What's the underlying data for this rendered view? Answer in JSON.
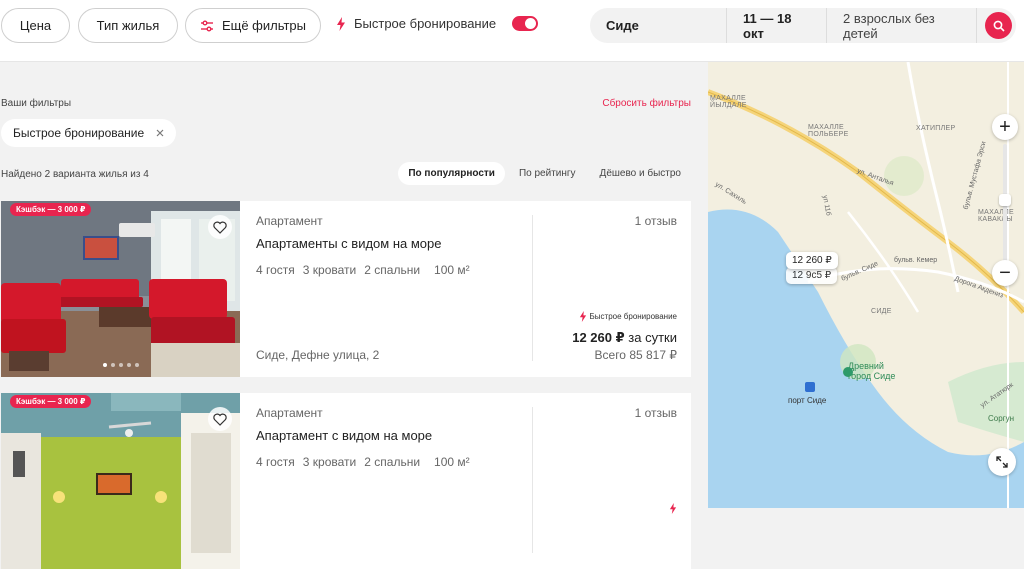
{
  "filters_bar": {
    "price": "Цена",
    "housing_type": "Тип жилья",
    "more_filters": "Ещё фильтры",
    "instant_booking": "Быстрое бронирование",
    "instant_booking_on": true
  },
  "search": {
    "location": "Сиде",
    "dates": "11 — 18 окт",
    "guests": "2 взрослых без детей"
  },
  "active_filters": {
    "title": "Ваши фильтры",
    "reset": "Сбросить фильтры",
    "chips": [
      "Быстрое бронирование"
    ]
  },
  "results": {
    "found_text": "Найдено 2 варианта жилья из 4",
    "sort_options": [
      "По популярности",
      "По рейтингу",
      "Дёшево и быстро"
    ],
    "active_sort": "По популярности"
  },
  "listings": [
    {
      "cashback": "Кэшбэк — 3 000 ₽",
      "type": "Апартамент",
      "title": "Апартаменты с видом на море",
      "guests": "4 гостя",
      "beds": "3 кровати",
      "bedrooms": "2 спальни",
      "area": "100 м²",
      "address": "Сиде, Дефне улица, 2",
      "reviews": "1 отзыв",
      "instant_label": "Быстрое бронирование",
      "price": "12 260 ₽",
      "price_unit": "за сутки",
      "total": "Всего 85 817 ₽"
    },
    {
      "cashback": "Кэшбэк — 3 000 ₽",
      "type": "Апартамент",
      "title": "Апартамент с видом на море",
      "guests": "4 гостя",
      "beds": "3 кровати",
      "bedrooms": "2 спальни",
      "area": "100 м²",
      "reviews": "1 отзыв"
    }
  ],
  "map": {
    "price_pins": [
      "12 260 ₽",
      "12 9с5 ₽"
    ],
    "zoom_in": "+",
    "zoom_out": "−",
    "labels": {
      "mahalle_dylali": "МАХАЛЛЕ\nЙЫЛДАЛЕ",
      "mahalle_polbe": "МАХАЛЛЕ\nПОЛЬБЕРЕ",
      "hatipler": "ХАТИПЛЕР",
      "mahalle_kavakli": "МАХАЛЛЕ\nКАВАКЛЫ",
      "side": "СИДЕ",
      "sorgun": "Соргун"
    },
    "streets": {
      "antalya": "ул. Анталья",
      "sahil": "ул. Сахиль",
      "kemer": "бульв. Кемер",
      "side_blvd": "бульв. Сиде",
      "akdeniz": "Дорога Акдениз",
      "erosi": "бульв. Мустафа Эрси",
      "no11": "ул 11б",
      "ataturk": "ул. Ататюрк"
    },
    "poi_ancient": "Древний\nгород Сиде",
    "poi_port": "порт Сиде"
  }
}
